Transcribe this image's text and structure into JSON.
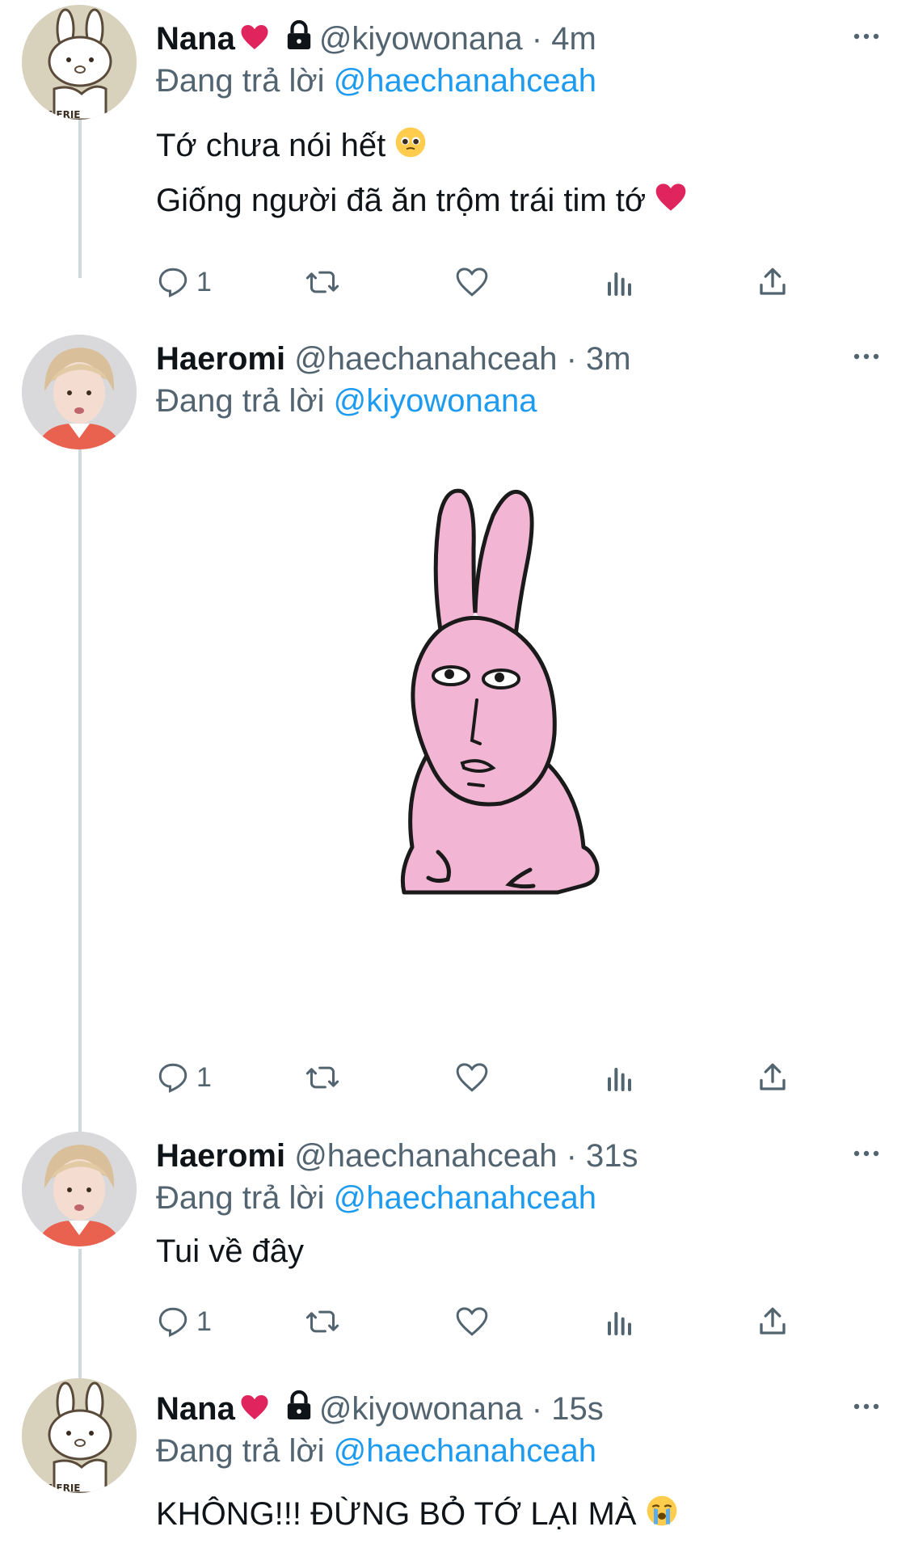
{
  "tweets": [
    {
      "name": "Nana",
      "handle": "@kiyowonana",
      "time": "· 4m",
      "replying_prefix": "Đang trả lời",
      "replying_to": "@haechanahceah",
      "lines": [
        "Tớ chưa nói hết",
        "Giống người đã ăn trộm trái tim tớ"
      ],
      "reply_count": "1",
      "avatar": "bunny-avatar"
    },
    {
      "name": "Haeromi",
      "handle": "@haechanahceah",
      "time": "· 3m",
      "replying_prefix": "Đang trả lời",
      "replying_to": "@kiyowonana",
      "lines": [],
      "image": "pink-rabbit-sticker",
      "reply_count": "1",
      "avatar": "person-avatar"
    },
    {
      "name": "Haeromi",
      "handle": "@haechanahceah",
      "time": "· 31s",
      "replying_prefix": "Đang trả lời",
      "replying_to": "@haechanahceah",
      "lines": [
        "Tui về đây"
      ],
      "reply_count": "1",
      "avatar": "person-avatar"
    },
    {
      "name": "Nana",
      "handle": "@kiyowonana",
      "time": "· 15s",
      "replying_prefix": "Đang trả lời",
      "replying_to": "@haechanahceah",
      "lines": [
        "KHÔNG!!! ĐỪNG BỎ TỚ LẠI MÀ"
      ],
      "avatar": "bunny-avatar"
    }
  ],
  "colors": {
    "text": "#0f1419",
    "muted": "#536471",
    "link": "#1d9bf0",
    "heart": "#e0245e",
    "thread_line": "#cfd9de",
    "sticker_pink": "#f2b5d4"
  }
}
